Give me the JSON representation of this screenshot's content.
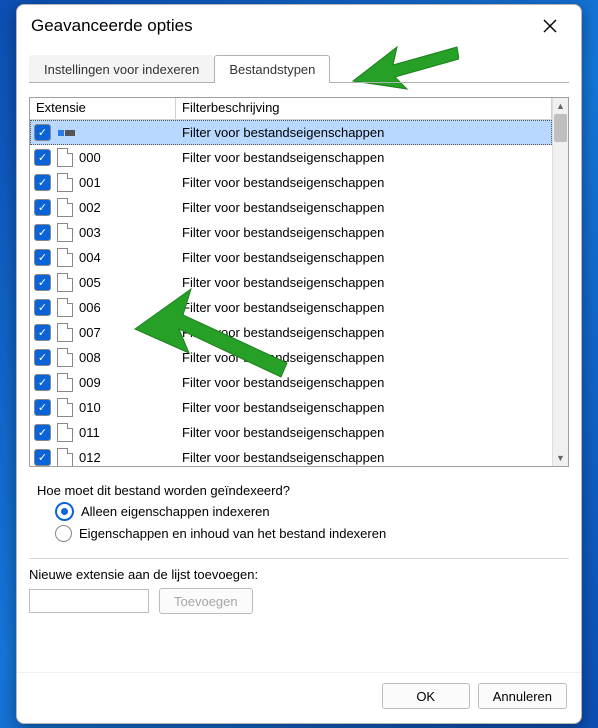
{
  "window": {
    "title": "Geavanceerde opties"
  },
  "tabs": {
    "settings": "Instellingen voor indexeren",
    "filetypes": "Bestandstypen"
  },
  "columns": {
    "extension": "Extensie",
    "description": "Filterbeschrijving"
  },
  "rows": [
    {
      "ext": "",
      "desc": "Filter voor bestandseigenschappen",
      "selected": true,
      "special": true
    },
    {
      "ext": "000",
      "desc": "Filter voor bestandseigenschappen"
    },
    {
      "ext": "001",
      "desc": "Filter voor bestandseigenschappen"
    },
    {
      "ext": "002",
      "desc": "Filter voor bestandseigenschappen"
    },
    {
      "ext": "003",
      "desc": "Filter voor bestandseigenschappen"
    },
    {
      "ext": "004",
      "desc": "Filter voor bestandseigenschappen"
    },
    {
      "ext": "005",
      "desc": "Filter voor bestandseigenschappen"
    },
    {
      "ext": "006",
      "desc": "Filter voor bestandseigenschappen"
    },
    {
      "ext": "007",
      "desc": "Filter voor bestandseigenschappen"
    },
    {
      "ext": "008",
      "desc": "Filter voor bestandseigenschappen"
    },
    {
      "ext": "009",
      "desc": "Filter voor bestandseigenschappen"
    },
    {
      "ext": "010",
      "desc": "Filter voor bestandseigenschappen"
    },
    {
      "ext": "011",
      "desc": "Filter voor bestandseigenschappen"
    },
    {
      "ext": "012",
      "desc": "Filter voor bestandseigenschappen"
    }
  ],
  "indexing": {
    "question": "Hoe moet dit bestand worden geïndexeerd?",
    "option_properties": "Alleen eigenschappen indexeren",
    "option_contents": "Eigenschappen en inhoud van het bestand indexeren"
  },
  "add_extension": {
    "label": "Nieuwe extensie aan de lijst toevoegen:",
    "value": "",
    "button": "Toevoegen"
  },
  "buttons": {
    "ok": "OK",
    "cancel": "Annuleren"
  }
}
